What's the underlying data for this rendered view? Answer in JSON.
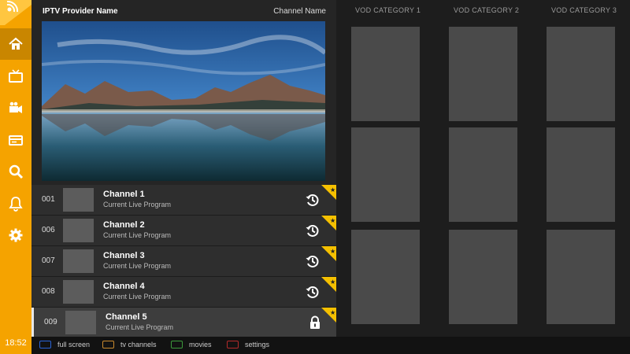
{
  "header": {
    "provider": "IPTV Provider Name",
    "channel_name": "Channel Name"
  },
  "sidebar": {
    "time": "18:52",
    "items": [
      {
        "icon": "home-icon",
        "active": true
      },
      {
        "icon": "tv-icon"
      },
      {
        "icon": "video-camera-icon"
      },
      {
        "icon": "ticket-icon"
      },
      {
        "icon": "search-icon"
      },
      {
        "icon": "bell-icon"
      },
      {
        "icon": "gear-icon"
      }
    ]
  },
  "preview": {
    "image": "mountain-lake-landscape"
  },
  "channels": [
    {
      "number": "001",
      "name": "Channel 1",
      "program": "Current Live Program",
      "action_icon": "history-icon"
    },
    {
      "number": "006",
      "name": "Channel 2",
      "program": "Current Live Program",
      "action_icon": "history-icon"
    },
    {
      "number": "007",
      "name": "Channel 3",
      "program": "Current Live Program",
      "action_icon": "history-icon"
    },
    {
      "number": "008",
      "name": "Channel 4",
      "program": "Current Live Program",
      "action_icon": "history-icon"
    },
    {
      "number": "009",
      "name": "Channel 5",
      "program": "Current Live Program",
      "action_icon": "lock-icon",
      "selected": true
    }
  ],
  "vod": {
    "categories": [
      "VOD CATEGORY 1",
      "VOD CATEGORY 2",
      "VOD CATEGORY 3"
    ]
  },
  "legend": [
    {
      "label": "full screen",
      "color": "#2a64d8"
    },
    {
      "label": "tv channels",
      "color": "#c98a2e"
    },
    {
      "label": "movies",
      "color": "#3c9a3c"
    },
    {
      "label": "settings",
      "color": "#b32a2a"
    }
  ],
  "colors": {
    "accent": "#f5a300",
    "star": "#f5c000"
  }
}
